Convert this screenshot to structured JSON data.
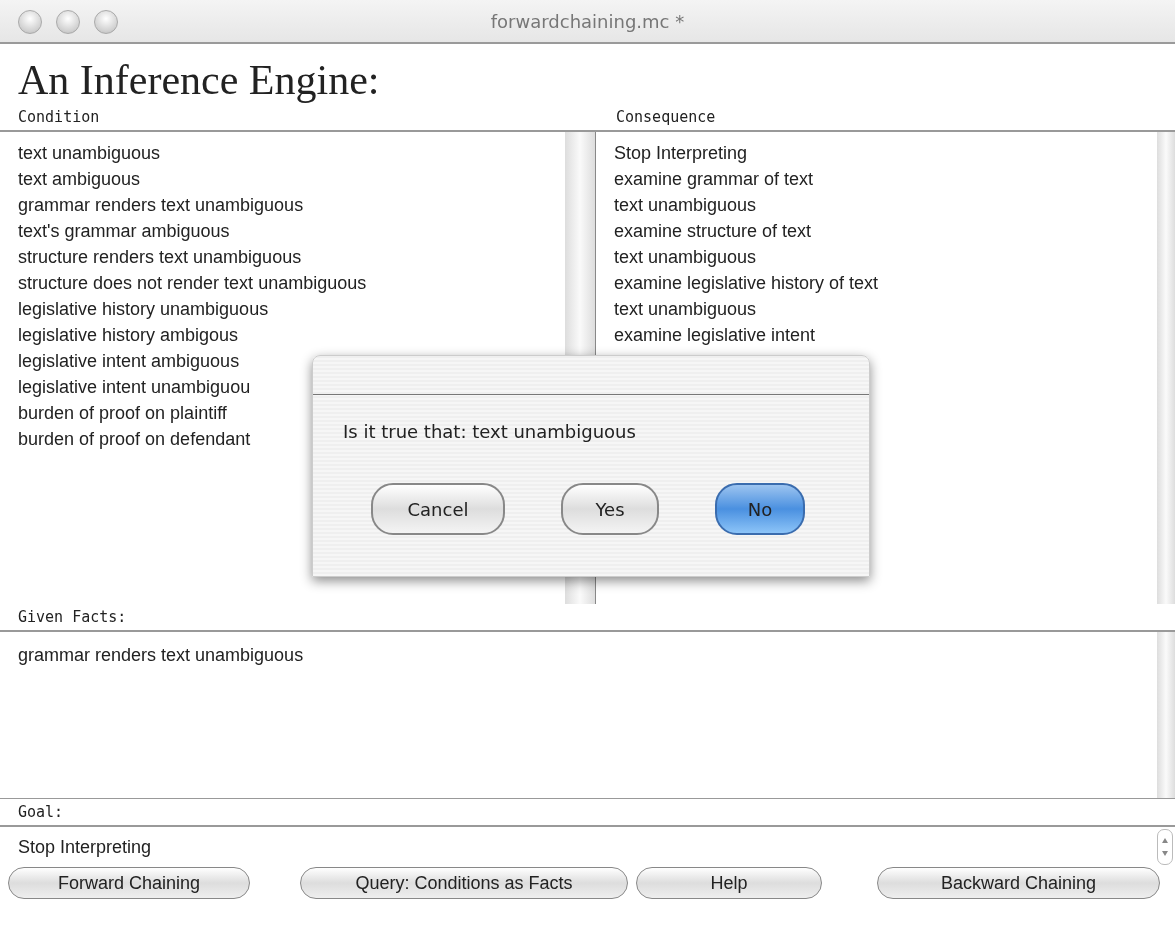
{
  "window": {
    "title": "forwardchaining.mc *"
  },
  "heading": "An Inference Engine:",
  "rules": {
    "condition_label": "Condition",
    "consequence_label": "Consequence",
    "conditions": [
      "text unambiguous",
      "text ambiguous",
      "grammar renders text unambiguous",
      "text's grammar ambiguous",
      "structure renders text unambiguous",
      "structure does not render text unambiguous",
      "legislative history unambiguous",
      "legislative history ambigous",
      "legislative intent ambiguous",
      "legislative intent unambiguou",
      "burden of proof on plaintiff",
      "burden of proof on defendant"
    ],
    "consequences": [
      "Stop Interpreting",
      "examine grammar of text",
      "text unambiguous",
      "examine structure of text",
      "text unambiguous",
      "examine legislative history of text",
      "text unambiguous",
      "examine legislative intent"
    ]
  },
  "given_facts": {
    "label": "Given Facts:",
    "items": [
      "grammar renders text unambiguous"
    ]
  },
  "goal": {
    "label": "Goal:",
    "value": "Stop Interpreting"
  },
  "buttons": [
    "Forward Chaining",
    "Query: Conditions as Facts",
    "Help",
    "Backward Chaining"
  ],
  "dialog": {
    "message": "Is it true that: text unambiguous",
    "buttons": [
      {
        "label": "Cancel",
        "default": false
      },
      {
        "label": "Yes",
        "default": false
      },
      {
        "label": "No",
        "default": true
      }
    ]
  }
}
